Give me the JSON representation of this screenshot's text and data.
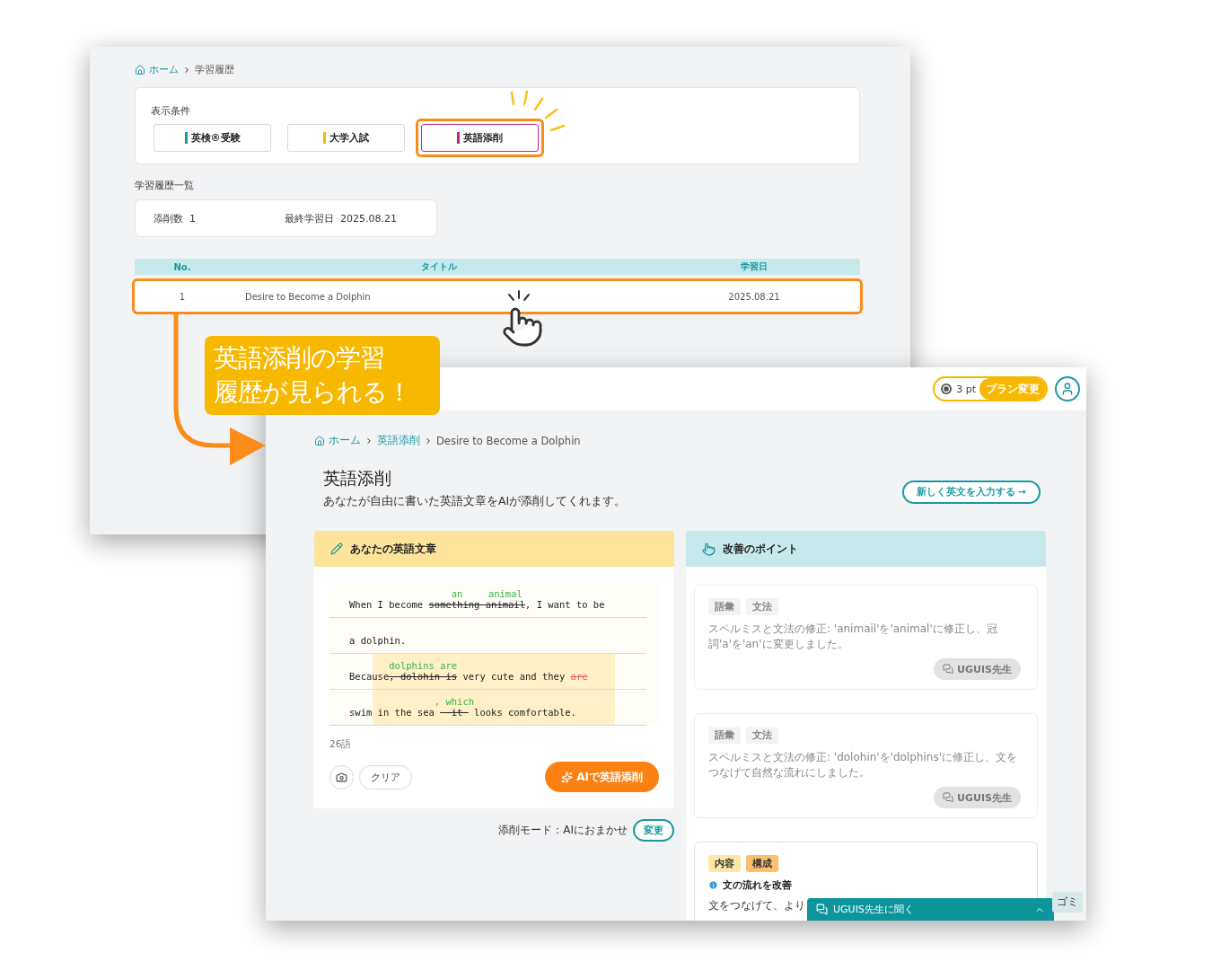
{
  "history_window": {
    "breadcrumb": [
      {
        "label": "ホーム",
        "link": true
      },
      {
        "label": "学習履歴",
        "link": false
      }
    ],
    "filter": {
      "label": "表示条件",
      "tabs": [
        {
          "label": "英検®受験",
          "selected": false,
          "emphasized": false,
          "color": "#1a9aa0"
        },
        {
          "label": "大学入試",
          "selected": false,
          "emphasized": false,
          "color": "#f5b800"
        },
        {
          "label": "英語添削",
          "selected": true,
          "emphasized": true,
          "color": "#c0288a"
        }
      ]
    },
    "section_title": "学習履歴一覧",
    "stats": [
      {
        "label": "添削数",
        "value": "1"
      },
      {
        "label": "最終学習日",
        "value": "2025.08.21"
      }
    ],
    "table": {
      "columns": [
        "No.",
        "タイトル",
        "学習日"
      ],
      "rows": [
        {
          "cells": [
            "1",
            "Desire to Become a Dolphin",
            "2025.08.21"
          ],
          "emphasized": true
        }
      ]
    }
  },
  "callout": {
    "lines": [
      "英語添削の学習",
      "履歴が見られる！"
    ]
  },
  "correction_window": {
    "points": "3 pt",
    "plan_button": "プラン変更",
    "breadcrumb": [
      {
        "label": "ホーム",
        "link": true
      },
      {
        "label": "英語添削",
        "link": true
      },
      {
        "label": "Desire to Become a Dolphin",
        "link": false
      }
    ],
    "title": "英語添削",
    "subtitle": "あなたが自由に書いた英語文章をAIが添削してくれます。",
    "new_button": "新しく英文を入力する →",
    "essay_panel": {
      "title": "あなたの英語文章",
      "lines": [
        {
          "highlighted": false,
          "segments": [
            {
              "kind": "plain",
              "text": "When I become "
            },
            {
              "kind": "replace",
              "old": "something ",
              "new": "an"
            },
            {
              "kind": "replace",
              "old": "animail",
              "new": "animal"
            },
            {
              "kind": "plain",
              "text": ", I want to be"
            }
          ]
        },
        {
          "highlighted": false,
          "segments": [
            {
              "kind": "plain",
              "text": "a dolphin."
            }
          ]
        },
        {
          "highlighted": true,
          "segments": [
            {
              "kind": "plain",
              "text": "Because"
            },
            {
              "kind": "replace",
              "old": ", dolohin is",
              "new": "dolphins are"
            },
            {
              "kind": "plain",
              "text": " very cute and they "
            },
            {
              "kind": "delete",
              "old": "are"
            }
          ]
        },
        {
          "highlighted": true,
          "segments": [
            {
              "kind": "plain",
              "text": "swim in the sea"
            },
            {
              "kind": "replace",
              "old": "  it ",
              "new": ", which"
            },
            {
              "kind": "plain",
              "text": "looks comfortable."
            }
          ]
        }
      ],
      "word_count": "26語",
      "clear_button": "クリア",
      "submit_button": "AIで英語添削"
    },
    "mode": {
      "label": "添削モード：AIにおまかせ",
      "button": "変更"
    },
    "points_panel": {
      "title": "改善のポイント",
      "cards": [
        {
          "faded": true,
          "tags": [
            {
              "label": "語彙",
              "color": "#f3f3f3"
            },
            {
              "label": "文法",
              "color": "#f3f3f3"
            }
          ],
          "text": "スペルミスと文法の修正: 'animail'を'animal'に修正し、冠詞'a'を'an'に変更しました。",
          "button": "UGUIS先生"
        },
        {
          "faded": true,
          "tags": [
            {
              "label": "語彙",
              "color": "#f3f3f3"
            },
            {
              "label": "文法",
              "color": "#f3f3f3"
            }
          ],
          "text": "スペルミスと文法の修正: 'dolohin'を'dolphins'に修正し、文をつなげて自然な流れにしました。",
          "button": "UGUIS先生"
        },
        {
          "faded": false,
          "tags": [
            {
              "label": "内容",
              "color": "#fde7a6"
            },
            {
              "label": "構成",
              "color": "#fbbf6e"
            }
          ],
          "heading": "文の流れを改善",
          "text": "文をつなげて、より"
        }
      ]
    },
    "chat_bar": "UGUIS先生に聞く",
    "tooltip": "ゴミ"
  }
}
